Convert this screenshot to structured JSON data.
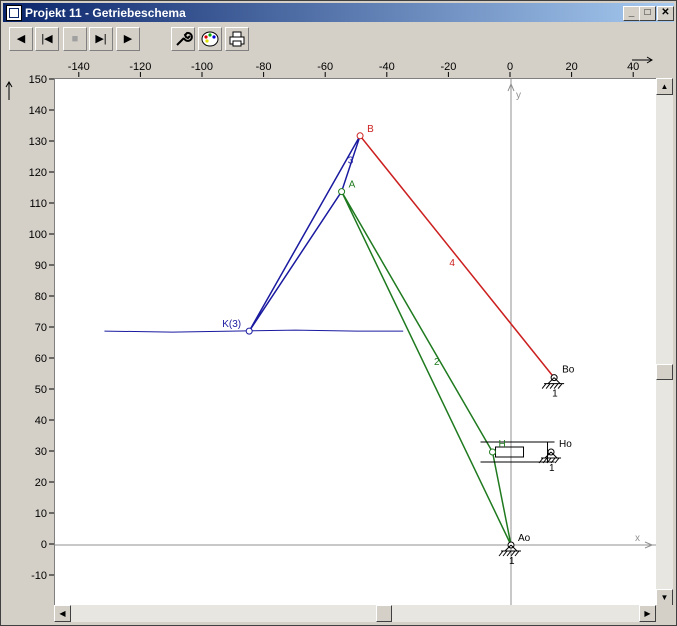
{
  "window": {
    "title": "Projekt 11 - Getriebeschema",
    "controls": {
      "minimize": "_",
      "maximize": "□",
      "close": "✕"
    }
  },
  "toolbar": {
    "buttons": [
      {
        "name": "play-backward",
        "icon": "play-backward-icon",
        "glyph": "◀",
        "enabled": true
      },
      {
        "name": "skip-to-start",
        "icon": "skip-start-icon",
        "glyph": "|◀",
        "enabled": true
      },
      {
        "name": "stop",
        "icon": "stop-icon",
        "glyph": "■",
        "enabled": false
      },
      {
        "name": "skip-to-end",
        "icon": "skip-end-icon",
        "glyph": "▶|",
        "enabled": true
      },
      {
        "name": "play-forward",
        "icon": "play-forward-icon",
        "glyph": "▶",
        "enabled": true
      },
      {
        "name": "settings",
        "icon": "wrench-icon",
        "glyph": "🔧",
        "enabled": true
      },
      {
        "name": "colors",
        "icon": "palette-icon",
        "glyph": "🎨",
        "enabled": true
      },
      {
        "name": "print",
        "icon": "printer-icon",
        "glyph": "🖶",
        "enabled": true
      }
    ]
  },
  "axes": {
    "x_ticks": [
      -140,
      -120,
      -100,
      -80,
      -60,
      -40,
      -20,
      0,
      20,
      40
    ],
    "y_ticks": [
      150,
      140,
      130,
      120,
      110,
      100,
      90,
      80,
      70,
      60,
      50,
      40,
      30,
      20,
      10,
      0,
      -10
    ],
    "x_label": "x",
    "y_label": "y"
  },
  "colors": {
    "link_blue": "#1a1aa0",
    "link_green": "#1f7a1f",
    "link_red": "#cc1f1f",
    "axis_gray": "#909090"
  },
  "mechanism": {
    "points": {
      "Ao": {
        "label": "Ao",
        "x": 0,
        "y": 0
      },
      "A": {
        "label": "A",
        "x": -55,
        "y": 114
      },
      "B": {
        "label": "B",
        "x": -49,
        "y": 132
      },
      "Bo": {
        "label": "Bo",
        "x": 14,
        "y": 54
      },
      "K": {
        "label": "K(3)",
        "x": -85,
        "y": 69
      },
      "H": {
        "label": "H",
        "x": -6,
        "y": 30
      },
      "Ho": {
        "label": "Ho",
        "x": 13,
        "y": 30
      }
    },
    "link_labels": {
      "link2": "2",
      "link3": "3",
      "link4": "4"
    },
    "ground_label": "1",
    "coupler_curve_y": 69
  },
  "scrollbars": {
    "vertical": {
      "position": 0.56
    },
    "horizontal": {
      "position": 0.55
    }
  }
}
